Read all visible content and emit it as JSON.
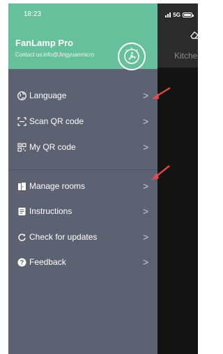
{
  "status_bar": {
    "time": "18:23",
    "network": "5G"
  },
  "header": {
    "app_name": "FanLamp Pro",
    "contact": "Contact us:info@Jingyuanmicro"
  },
  "background_app": {
    "label": "Kitche"
  },
  "menu": {
    "items": [
      {
        "label": "Language",
        "icon": "globe-icon"
      },
      {
        "label": "Scan QR code",
        "icon": "scan-icon"
      },
      {
        "label": "My QR code",
        "icon": "qr-code-icon"
      },
      {
        "label": "Manage rooms",
        "icon": "door-icon"
      },
      {
        "label": "Instructions",
        "icon": "document-icon"
      },
      {
        "label": "Check for updates",
        "icon": "refresh-icon"
      },
      {
        "label": "Feedback",
        "icon": "help-icon"
      }
    ],
    "chevron": ">"
  },
  "colors": {
    "header_bg": "#67c09c",
    "drawer_bg": "#5c6272",
    "annotation_arrow": "#e84b4b"
  }
}
